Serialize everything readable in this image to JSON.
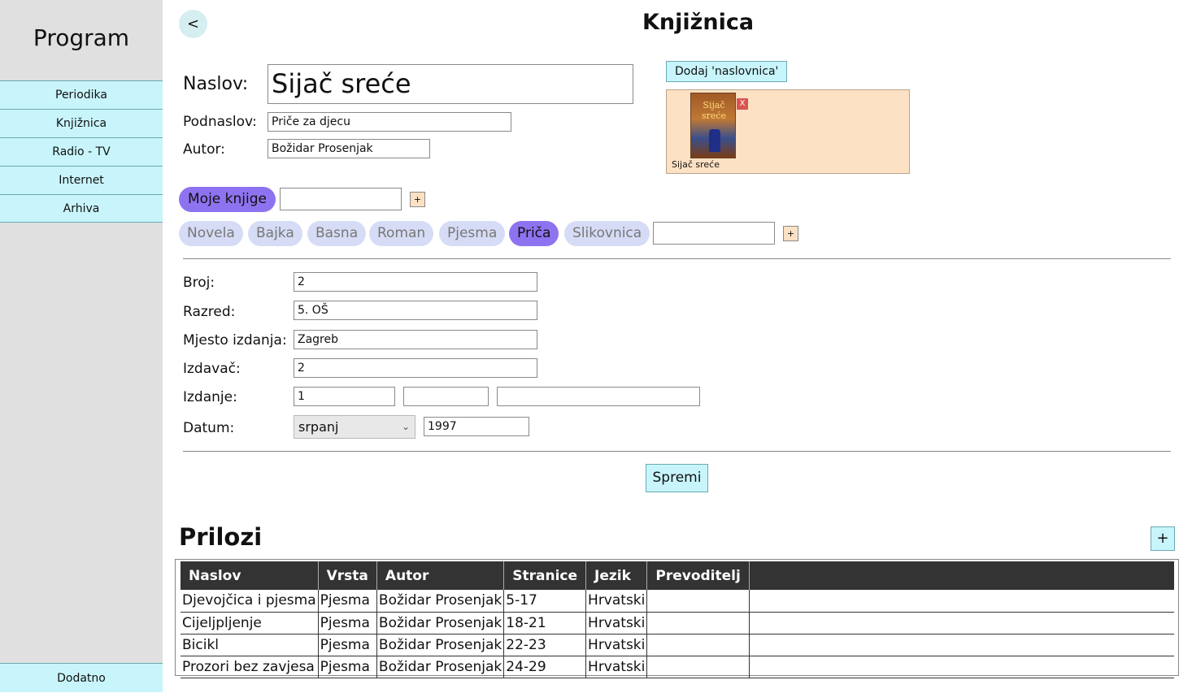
{
  "sidebar": {
    "title": "Program",
    "items": [
      {
        "label": "Periodika"
      },
      {
        "label": "Knjižnica"
      },
      {
        "label": "Radio - TV"
      },
      {
        "label": "Internet"
      },
      {
        "label": "Arhiva"
      }
    ],
    "extra_label": "Dodatno"
  },
  "header": {
    "back_label": "<",
    "title": "Knjižnica"
  },
  "form": {
    "naslov_label": "Naslov:",
    "naslov_value": "Sijač sreće",
    "podnaslov_label": "Podnaslov:",
    "podnaslov_value": "Priče za djecu",
    "autor_label": "Autor:",
    "autor_value": "Božidar Prosenjak",
    "broj_label": "Broj:",
    "broj_value": "2",
    "razred_label": "Razred:",
    "razred_value": "5. OŠ",
    "mjesto_label": "Mjesto izdanja:",
    "mjesto_value": "Zagreb",
    "izdavac_label": "Izdavač:",
    "izdavac_value": "2",
    "izdanje_label": "Izdanje:",
    "izdanje_value": "1",
    "izdanje_value2": "",
    "izdanje_value3": "",
    "datum_label": "Datum:",
    "datum_month": "srpanj",
    "datum_year": "1997",
    "save_label": "Spremi"
  },
  "cover": {
    "add_label": "Dodaj 'naslovnica'",
    "remove_label": "X",
    "image_text_line1": "Sijač",
    "image_text_line2": "sreće",
    "caption": "Sijač sreće"
  },
  "collections": {
    "active_label": "Moje knjige",
    "new_value": "",
    "add_label": "+"
  },
  "genres": {
    "items": [
      {
        "label": "Novela",
        "active": false
      },
      {
        "label": "Bajka",
        "active": false
      },
      {
        "label": "Basna",
        "active": false
      },
      {
        "label": "Roman",
        "active": false
      },
      {
        "label": "Pjesma",
        "active": false
      },
      {
        "label": "Priča",
        "active": true
      },
      {
        "label": "Slikovnica",
        "active": false
      }
    ],
    "new_value": "",
    "add_label": "+"
  },
  "attachments": {
    "title": "Prilozi",
    "add_label": "+",
    "columns": [
      "Naslov",
      "Vrsta",
      "Autor",
      "Stranice",
      "Jezik",
      "Prevoditelj"
    ],
    "rows": [
      [
        "Djevojčica i pjesma",
        "Pjesma",
        "Božidar Prosenjak",
        "5-17",
        "Hrvatski",
        ""
      ],
      [
        "Cijeljpljenje",
        "Pjesma",
        "Božidar Prosenjak",
        "18-21",
        "Hrvatski",
        ""
      ],
      [
        "Bicikl",
        "Pjesma",
        "Božidar Prosenjak",
        "22-23",
        "Hrvatski",
        ""
      ],
      [
        "Prozori bez zavjesa",
        "Pjesma",
        "Božidar Prosenjak",
        "24-29",
        "Hrvatski",
        ""
      ]
    ]
  },
  "colors": {
    "accent": "#c8f5fb",
    "pill_active": "#8d73f0",
    "pill_inactive": "#d6dcf5",
    "sidebar_bg": "#e0e0e0",
    "table_header": "#333333"
  }
}
